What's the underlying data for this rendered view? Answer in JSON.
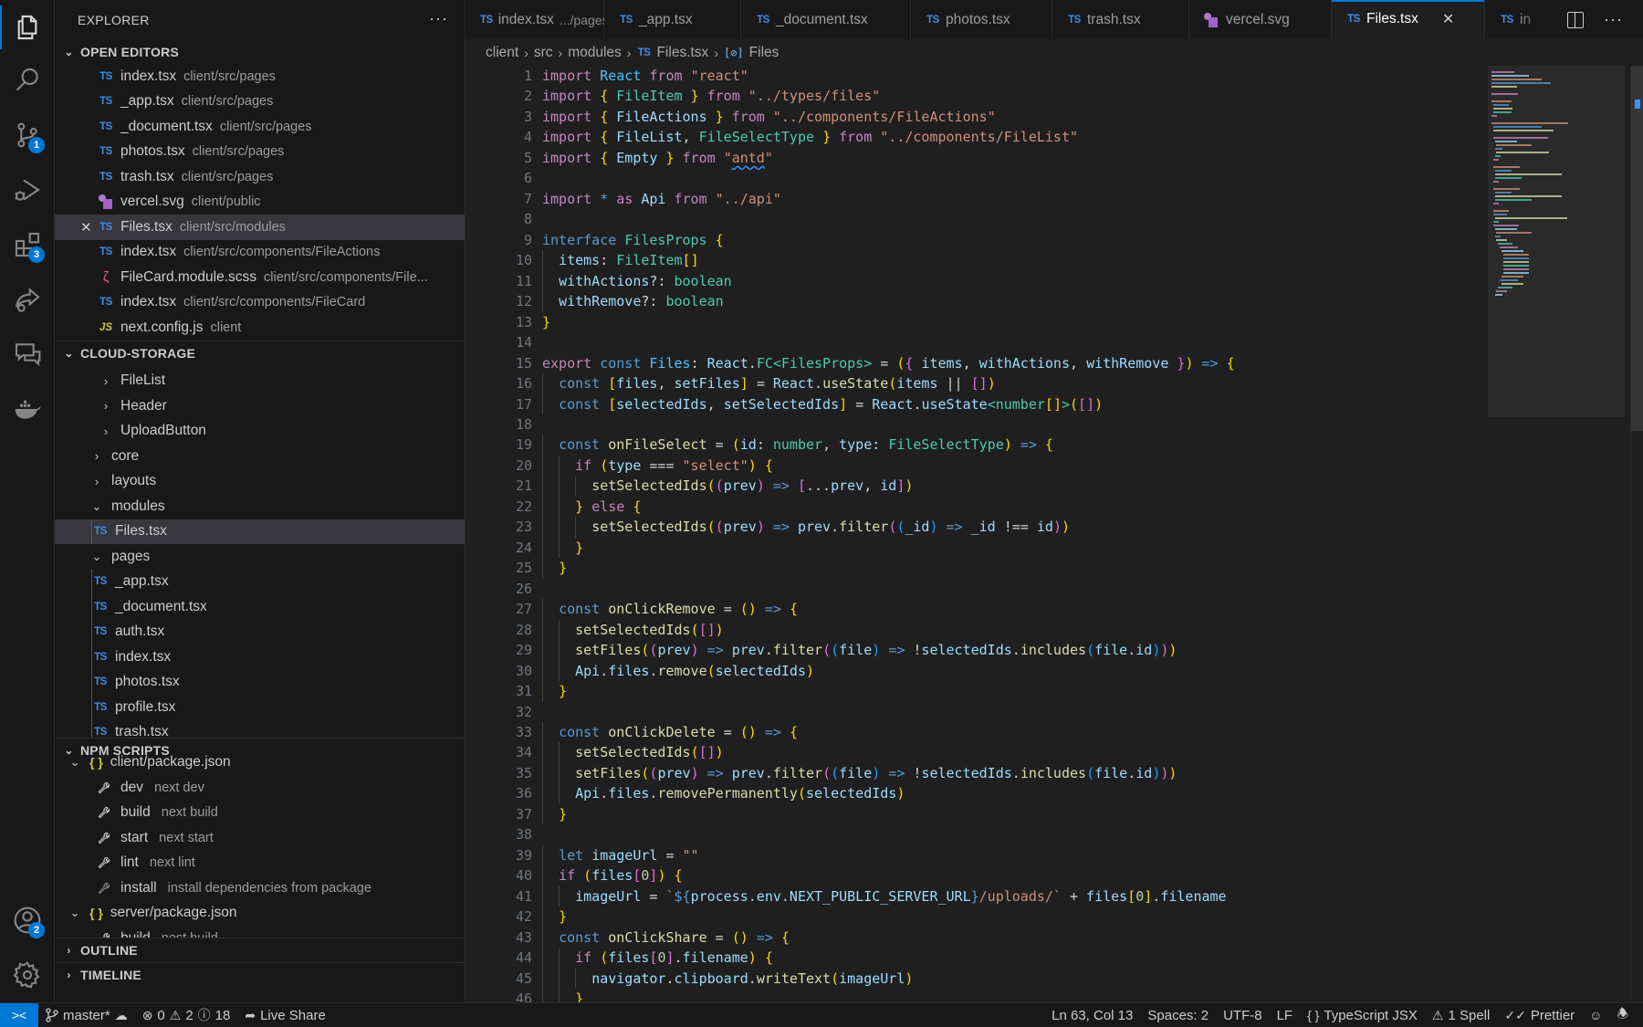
{
  "activity_bar": {
    "items": [
      {
        "name": "explorer",
        "active": true
      },
      {
        "name": "search"
      },
      {
        "name": "source-control",
        "badge": "1"
      },
      {
        "name": "run-debug"
      },
      {
        "name": "extensions",
        "badge": "3"
      },
      {
        "name": "live-share"
      },
      {
        "name": "comments"
      },
      {
        "name": "docker"
      }
    ],
    "bottom": [
      {
        "name": "accounts",
        "badge": "2"
      },
      {
        "name": "manage"
      }
    ]
  },
  "sidebar": {
    "title": "EXPLORER",
    "more": "···",
    "open_editors": {
      "header": "OPEN EDITORS",
      "items": [
        {
          "icon": "TS",
          "name": "index.tsx",
          "path": "client/src/pages"
        },
        {
          "icon": "TS",
          "name": "_app.tsx",
          "path": "client/src/pages"
        },
        {
          "icon": "TS",
          "name": "_document.tsx",
          "path": "client/src/pages"
        },
        {
          "icon": "TS",
          "name": "photos.tsx",
          "path": "client/src/pages"
        },
        {
          "icon": "TS",
          "name": "trash.tsx",
          "path": "client/src/pages"
        },
        {
          "icon": "SVG",
          "name": "vercel.svg",
          "path": "client/public"
        },
        {
          "icon": "TS",
          "name": "Files.tsx",
          "path": "client/src/modules",
          "selected": true
        },
        {
          "icon": "TS",
          "name": "index.tsx",
          "path": "client/src/components/FileActions"
        },
        {
          "icon": "SCSS",
          "name": "FileCard.module.scss",
          "path": "client/src/components/File..."
        },
        {
          "icon": "TS",
          "name": "index.tsx",
          "path": "client/src/components/FileCard"
        },
        {
          "icon": "JS",
          "name": "next.config.js",
          "path": "client"
        }
      ]
    },
    "cloud_storage": {
      "header": "CLOUD-STORAGE",
      "items": [
        {
          "type": "folder",
          "name": "FileList",
          "expanded": false,
          "depth": 2
        },
        {
          "type": "folder",
          "name": "Header",
          "expanded": false,
          "depth": 2
        },
        {
          "type": "folder",
          "name": "UploadButton",
          "expanded": false,
          "depth": 2
        },
        {
          "type": "folder",
          "name": "core",
          "expanded": false,
          "depth": 1
        },
        {
          "type": "folder",
          "name": "layouts",
          "expanded": false,
          "depth": 1
        },
        {
          "type": "folder",
          "name": "modules",
          "expanded": true,
          "depth": 1
        },
        {
          "type": "file",
          "icon": "TS",
          "name": "Files.tsx",
          "depth": 2,
          "selected": true
        },
        {
          "type": "folder",
          "name": "pages",
          "expanded": true,
          "depth": 1
        },
        {
          "type": "file",
          "icon": "TS",
          "name": "_app.tsx",
          "depth": 2
        },
        {
          "type": "file",
          "icon": "TS",
          "name": "_document.tsx",
          "depth": 2
        },
        {
          "type": "file",
          "icon": "TS",
          "name": "auth.tsx",
          "depth": 2
        },
        {
          "type": "file",
          "icon": "TS",
          "name": "index.tsx",
          "depth": 2
        },
        {
          "type": "file",
          "icon": "TS",
          "name": "photos.tsx",
          "depth": 2
        },
        {
          "type": "file",
          "icon": "TS",
          "name": "profile.tsx",
          "depth": 2
        },
        {
          "type": "file",
          "icon": "TS",
          "name": "trash.tsx",
          "depth": 2
        }
      ]
    },
    "npm_scripts": {
      "header": "NPM SCRIPTS",
      "packages": [
        {
          "name": "client/package.json",
          "scripts": [
            {
              "name": "dev",
              "cmd": "next dev"
            },
            {
              "name": "build",
              "cmd": "next build"
            },
            {
              "name": "start",
              "cmd": "next start"
            },
            {
              "name": "lint",
              "cmd": "next lint"
            },
            {
              "name": "install",
              "cmd": "install dependencies from package",
              "dim": true
            }
          ]
        },
        {
          "name": "server/package.json",
          "scripts": [
            {
              "name": "build",
              "cmd": "nest build"
            }
          ]
        }
      ]
    },
    "outline": "OUTLINE",
    "timeline": "TIMELINE"
  },
  "tabs": [
    {
      "icon": "TS",
      "name": "index.tsx",
      "desc": ".../pages"
    },
    {
      "icon": "TS",
      "name": "_app.tsx"
    },
    {
      "icon": "TS",
      "name": "_document.tsx"
    },
    {
      "icon": "TS",
      "name": "photos.tsx"
    },
    {
      "icon": "TS",
      "name": "trash.tsx"
    },
    {
      "icon": "SVG",
      "name": "vercel.svg"
    },
    {
      "icon": "TS",
      "name": "Files.tsx",
      "active": true
    },
    {
      "icon": "TS",
      "name": "in"
    }
  ],
  "breadcrumb": [
    "client",
    "src",
    "modules",
    "Files.tsx",
    "Files"
  ],
  "editor": {
    "language": "TypeScript JSX",
    "lines": [
      "import React from \"react\"",
      "import { FileItem } from \"../types/files\"",
      "import { FileActions } from \"../components/FileActions\"",
      "import { FileList, FileSelectType } from \"../components/FileList\"",
      "import { Empty } from \"antd\"",
      "",
      "import * as Api from \"../api\"",
      "",
      "interface FilesProps {",
      "  items: FileItem[]",
      "  withActions?: boolean",
      "  withRemove?: boolean",
      "}",
      "",
      "export const Files: React.FC<FilesProps> = ({ items, withActions, withRemove }) => {",
      "  const [files, setFiles] = React.useState(items || [])",
      "  const [selectedIds, setSelectedIds] = React.useState<number[]>([])",
      "",
      "  const onFileSelect = (id: number, type: FileSelectType) => {",
      "    if (type === \"select\") {",
      "      setSelectedIds((prev) => [...prev, id])",
      "    } else {",
      "      setSelectedIds((prev) => prev.filter((_id) => _id !== id))",
      "    }",
      "  }",
      "",
      "  const onClickRemove = () => {",
      "    setSelectedIds([])",
      "    setFiles((prev) => prev.filter((file) => !selectedIds.includes(file.id)))",
      "    Api.files.remove(selectedIds)",
      "  }",
      "",
      "  const onClickDelete = () => {",
      "    setSelectedIds([])",
      "    setFiles((prev) => prev.filter((file) => !selectedIds.includes(file.id)))",
      "    Api.files.removePermanently(selectedIds)",
      "  }",
      "",
      "  let imageUrl = \"\"",
      "  if (files[0]) {",
      "    imageUrl = `${process.env.NEXT_PUBLIC_SERVER_URL}/uploads/` + files[0].filename",
      "  }",
      "  const onClickShare = () => {",
      "    if (files[0].filename) {",
      "      navigator.clipboard.writeText(imageUrl)",
      "    }"
    ]
  },
  "status_bar": {
    "branch": "master*",
    "errors": "0",
    "warnings": "2",
    "infos": "18",
    "live_share": "Live Share",
    "cursor": "Ln 63, Col 13",
    "spaces": "Spaces: 2",
    "encoding": "UTF-8",
    "eol": "LF",
    "language": "TypeScript JSX",
    "spell": "1 Spell",
    "formatter": "Prettier"
  },
  "colors": {
    "accent": "#0078d4",
    "background": "#1f1f1f",
    "sidebar": "#181818",
    "selection": "#37373d",
    "ts_icon": "#3b8eea",
    "js_icon": "#cbcb41"
  }
}
